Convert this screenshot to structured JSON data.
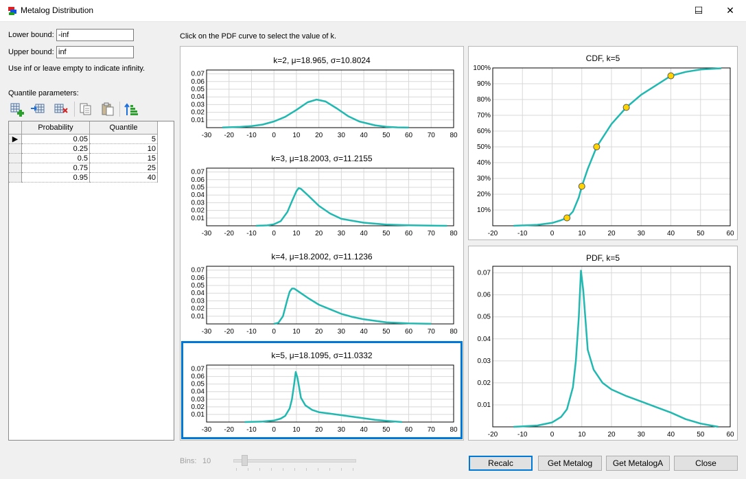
{
  "window": {
    "title": "Metalog Distribution",
    "min": "─",
    "max": "☐",
    "close": "✕"
  },
  "bounds": {
    "lower_label": "Lower bound:",
    "lower_value": "-inf",
    "upper_label": "Upper bound:",
    "upper_value": "inf",
    "hint": "Use inf or leave empty to indicate infinity."
  },
  "quantile": {
    "label": "Quantile parameters:",
    "headers": [
      "Probability",
      "Quantile"
    ],
    "rows": [
      [
        "0.05",
        "5"
      ],
      [
        "0.25",
        "10"
      ],
      [
        "0.5",
        "15"
      ],
      [
        "0.75",
        "25"
      ],
      [
        "0.95",
        "40"
      ]
    ],
    "current_marker": "▶"
  },
  "toolbar_icons": [
    "add-row-icon",
    "insert-row-icon",
    "delete-row-icon",
    "copy-icon",
    "paste-icon",
    "sort-icon"
  ],
  "instructions": "Click on the PDF curve to select the value of k.",
  "bins": {
    "label": "Bins:",
    "value": "10"
  },
  "buttons": {
    "recalc": "Recalc",
    "get_metalog": "Get Metalog",
    "get_metaloga": "Get MetalogA",
    "close": "Close"
  },
  "colors": {
    "curve": "#20b8b0",
    "point": "#ffd400",
    "selection": "#0078d7"
  },
  "chart_data": [
    {
      "type": "line",
      "title": "k=2, μ=18.965, σ=10.8024",
      "xlim": [
        -30,
        80
      ],
      "ylim": [
        0,
        0.075
      ],
      "xticks": [
        "-30",
        "-20",
        "-10",
        "0",
        "10",
        "20",
        "30",
        "40",
        "50",
        "60",
        "70",
        "80"
      ],
      "yticks": [
        "0.01",
        "0.02",
        "0.03",
        "0.04",
        "0.05",
        "0.06",
        "0.07"
      ],
      "x": [
        -23,
        -15,
        -10,
        -5,
        0,
        5,
        10,
        15,
        19,
        23,
        28,
        33,
        38,
        45,
        50,
        55,
        60
      ],
      "y": [
        0.0003,
        0.001,
        0.002,
        0.004,
        0.008,
        0.014,
        0.023,
        0.033,
        0.0365,
        0.034,
        0.025,
        0.015,
        0.008,
        0.003,
        0.0012,
        0.0004,
        0.0001
      ]
    },
    {
      "type": "line",
      "title": "k=3, μ=18.2003, σ=11.2155",
      "xlim": [
        -30,
        80
      ],
      "ylim": [
        0,
        0.075
      ],
      "xticks": [
        "-30",
        "-20",
        "-10",
        "0",
        "10",
        "20",
        "30",
        "40",
        "50",
        "60",
        "70",
        "80"
      ],
      "yticks": [
        "0.01",
        "0.02",
        "0.03",
        "0.04",
        "0.05",
        "0.06",
        "0.07"
      ],
      "x": [
        -8,
        -3,
        0,
        3,
        6,
        8,
        10,
        11,
        12,
        15,
        20,
        25,
        30,
        40,
        50,
        60,
        70,
        77
      ],
      "y": [
        0,
        0.0005,
        0.002,
        0.006,
        0.018,
        0.032,
        0.045,
        0.049,
        0.048,
        0.04,
        0.026,
        0.016,
        0.009,
        0.004,
        0.0015,
        0.0006,
        0.0002,
        0
      ]
    },
    {
      "type": "line",
      "title": "k=4, μ=18.2002, σ=11.1236",
      "xlim": [
        -30,
        80
      ],
      "ylim": [
        0,
        0.075
      ],
      "xticks": [
        "-30",
        "-20",
        "-10",
        "0",
        "10",
        "20",
        "30",
        "40",
        "50",
        "60",
        "70",
        "80"
      ],
      "yticks": [
        "0.01",
        "0.02",
        "0.03",
        "0.04",
        "0.05",
        "0.06",
        "0.07"
      ],
      "x": [
        0,
        2,
        4,
        6,
        7,
        8,
        9,
        10,
        12,
        15,
        20,
        25,
        30,
        35,
        40,
        50,
        60,
        70
      ],
      "y": [
        0,
        0.0015,
        0.01,
        0.032,
        0.042,
        0.046,
        0.046,
        0.044,
        0.04,
        0.034,
        0.025,
        0.019,
        0.013,
        0.009,
        0.006,
        0.002,
        0.0006,
        0.0001
      ]
    },
    {
      "type": "line",
      "title": "k=5, μ=18.1095, σ=11.0332",
      "xlim": [
        -30,
        80
      ],
      "ylim": [
        0,
        0.075
      ],
      "xticks": [
        "-30",
        "-20",
        "-10",
        "0",
        "10",
        "20",
        "30",
        "40",
        "50",
        "60",
        "70",
        "80"
      ],
      "yticks": [
        "0.01",
        "0.02",
        "0.03",
        "0.04",
        "0.05",
        "0.06",
        "0.07"
      ],
      "x": [
        -13,
        -5,
        0,
        3,
        5,
        7,
        8,
        9,
        9.7,
        10.5,
        12,
        14,
        17,
        20,
        25,
        30,
        35,
        40,
        45,
        50,
        57
      ],
      "y": [
        0,
        0.0006,
        0.002,
        0.0045,
        0.008,
        0.018,
        0.03,
        0.05,
        0.066,
        0.058,
        0.032,
        0.022,
        0.016,
        0.013,
        0.011,
        0.009,
        0.007,
        0.005,
        0.003,
        0.0015,
        0
      ]
    },
    {
      "type": "line",
      "title": "CDF, k=5",
      "xlim": [
        -20,
        60
      ],
      "ylim": [
        0,
        1
      ],
      "xticks": [
        "-20",
        "-10",
        "0",
        "10",
        "20",
        "30",
        "40",
        "50",
        "60"
      ],
      "yticks": [
        "10%",
        "20%",
        "30%",
        "40%",
        "50%",
        "60%",
        "70%",
        "80%",
        "90%",
        "100%"
      ],
      "x": [
        -13,
        -5,
        0,
        3,
        5,
        7,
        9,
        10,
        12,
        15,
        20,
        25,
        30,
        35,
        40,
        45,
        50,
        57
      ],
      "y": [
        0,
        0.006,
        0.018,
        0.035,
        0.05,
        0.09,
        0.18,
        0.25,
        0.36,
        0.5,
        0.645,
        0.75,
        0.83,
        0.89,
        0.95,
        0.975,
        0.99,
        0.998
      ],
      "points": [
        [
          5,
          0.05
        ],
        [
          10,
          0.25
        ],
        [
          15,
          0.5
        ],
        [
          25,
          0.75
        ],
        [
          40,
          0.95
        ]
      ]
    },
    {
      "type": "line",
      "title": "PDF, k=5",
      "xlim": [
        -20,
        60
      ],
      "ylim": [
        0,
        0.073
      ],
      "xticks": [
        "-20",
        "-10",
        "0",
        "10",
        "20",
        "30",
        "40",
        "50",
        "60"
      ],
      "yticks": [
        "0.01",
        "0.02",
        "0.03",
        "0.04",
        "0.05",
        "0.06",
        "0.07"
      ],
      "x": [
        -13,
        -5,
        0,
        3,
        5,
        7,
        8,
        9,
        9.7,
        10.5,
        12,
        14,
        17,
        20,
        25,
        30,
        35,
        40,
        45,
        50,
        56
      ],
      "y": [
        0,
        0.0006,
        0.002,
        0.0045,
        0.008,
        0.018,
        0.03,
        0.05,
        0.071,
        0.062,
        0.035,
        0.026,
        0.02,
        0.017,
        0.014,
        0.0115,
        0.009,
        0.0065,
        0.0035,
        0.0015,
        0
      ]
    }
  ]
}
